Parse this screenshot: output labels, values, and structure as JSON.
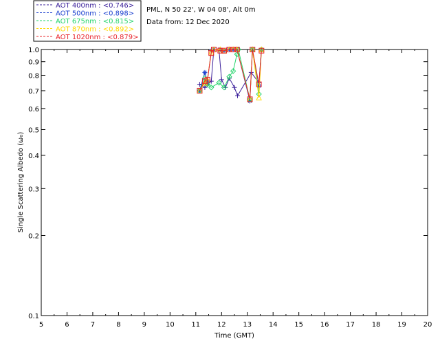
{
  "header": {
    "site": "PML, N 50 22', W 04 08', Alt 0m",
    "date": "Data from: 12 Dec 2020"
  },
  "legend": [
    {
      "label": "AOT  400nm : <0.746>",
      "color": "#3a1f9a"
    },
    {
      "label": "AOT  500nm : <0.898>",
      "color": "#1a3fcf"
    },
    {
      "label": "AOT  675nm : <0.815>",
      "color": "#22d46a"
    },
    {
      "label": "AOT  870nm : <0.892>",
      "color": "#ffd800"
    },
    {
      "label": "AOT 1020nm : <0.879>",
      "color": "#e8242a"
    }
  ],
  "chart_data": {
    "type": "line",
    "title": "",
    "xlabel": "Time (GMT)",
    "ylabel": "Single Scattering Albedo (ω₀)",
    "xlim": [
      5,
      20
    ],
    "ylim": [
      0.1,
      1.0
    ],
    "yscale": "log",
    "xticks": [
      5,
      6,
      7,
      8,
      9,
      10,
      11,
      12,
      13,
      14,
      15,
      16,
      17,
      18,
      19,
      20
    ],
    "yticks": [
      0.1,
      0.2,
      0.3,
      0.4,
      0.5,
      0.6,
      0.7,
      0.8,
      0.9,
      1.0
    ],
    "ytick_labels": [
      "0.1",
      "0.2",
      "0.3",
      "0.4",
      "0.5",
      "0.6",
      "0.7",
      "0.8",
      "0.9",
      "1.0"
    ],
    "series": [
      {
        "name": "AOT  400nm",
        "color": "#3a1f9a",
        "marker": "plus",
        "points": [
          [
            11.15,
            0.74
          ],
          [
            11.35,
            0.72
          ],
          [
            11.45,
            0.74
          ],
          [
            11.6,
            0.76
          ],
          [
            11.7,
            1.0
          ],
          [
            11.9,
            1.0
          ],
          [
            12.0,
            0.77
          ],
          [
            12.15,
            0.72
          ],
          [
            12.3,
            0.78
          ],
          [
            12.5,
            0.72
          ],
          [
            12.62,
            0.67
          ],
          [
            13.15,
            0.82
          ],
          [
            13.45,
            0.75
          ],
          [
            13.55,
            1.0
          ]
        ]
      },
      {
        "name": "AOT  500nm",
        "color": "#1a3fcf",
        "marker": "star",
        "points": [
          [
            11.15,
            0.7
          ],
          [
            11.35,
            0.82
          ],
          [
            11.45,
            0.76
          ],
          [
            11.6,
            0.99
          ],
          [
            11.7,
            1.0
          ],
          [
            11.95,
            1.0
          ],
          [
            12.1,
            0.99
          ],
          [
            12.3,
            1.0
          ],
          [
            12.45,
            1.0
          ],
          [
            12.6,
            1.0
          ],
          [
            13.1,
            0.64
          ],
          [
            13.2,
            1.0
          ],
          [
            13.45,
            0.73
          ],
          [
            13.55,
            1.0
          ]
        ]
      },
      {
        "name": "AOT  675nm",
        "color": "#22d46a",
        "marker": "diamond",
        "points": [
          [
            11.15,
            0.7
          ],
          [
            11.35,
            0.78
          ],
          [
            11.45,
            0.74
          ],
          [
            11.6,
            0.72
          ],
          [
            11.9,
            0.75
          ],
          [
            12.1,
            0.72
          ],
          [
            12.3,
            0.79
          ],
          [
            12.45,
            0.83
          ],
          [
            12.6,
            0.96
          ],
          [
            12.65,
            1.0
          ],
          [
            13.1,
            0.65
          ],
          [
            13.2,
            1.0
          ],
          [
            13.45,
            0.68
          ],
          [
            13.55,
            1.0
          ]
        ]
      },
      {
        "name": "AOT  870nm",
        "color": "#ffd800",
        "marker": "triangle",
        "points": [
          [
            11.15,
            0.7
          ],
          [
            11.35,
            0.75
          ],
          [
            11.45,
            0.77
          ],
          [
            11.6,
            0.98
          ],
          [
            11.7,
            1.0
          ],
          [
            11.95,
            1.0
          ],
          [
            12.1,
            0.99
          ],
          [
            12.3,
            1.0
          ],
          [
            12.45,
            1.0
          ],
          [
            12.6,
            1.0
          ],
          [
            13.1,
            0.65
          ],
          [
            13.2,
            1.0
          ],
          [
            13.45,
            0.66
          ],
          [
            13.55,
            1.0
          ]
        ]
      },
      {
        "name": "AOT 1020nm",
        "color": "#e8242a",
        "marker": "square",
        "points": [
          [
            11.15,
            0.7
          ],
          [
            11.35,
            0.76
          ],
          [
            11.45,
            0.77
          ],
          [
            11.6,
            0.97
          ],
          [
            11.7,
            1.0
          ],
          [
            11.95,
            0.99
          ],
          [
            12.1,
            0.99
          ],
          [
            12.3,
            1.0
          ],
          [
            12.45,
            1.0
          ],
          [
            12.6,
            1.0
          ],
          [
            13.1,
            0.65
          ],
          [
            13.2,
            1.0
          ],
          [
            13.45,
            0.74
          ],
          [
            13.55,
            0.99
          ]
        ]
      }
    ]
  }
}
